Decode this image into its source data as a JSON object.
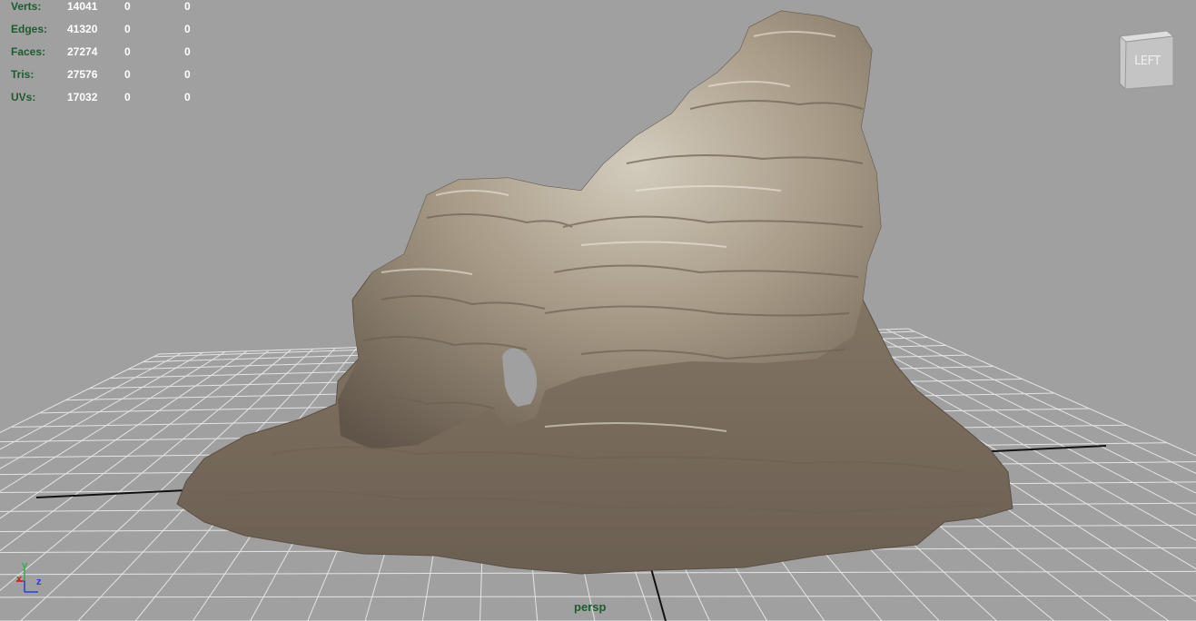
{
  "hud": {
    "rows": [
      {
        "label": "Verts:",
        "v1": "14041",
        "v2": "0",
        "v3": "0"
      },
      {
        "label": "Edges:",
        "v1": "41320",
        "v2": "0",
        "v3": "0"
      },
      {
        "label": "Faces:",
        "v1": "27274",
        "v2": "0",
        "v3": "0"
      },
      {
        "label": "Tris:",
        "v1": "27576",
        "v2": "0",
        "v3": "0"
      },
      {
        "label": "UVs:",
        "v1": "17032",
        "v2": "0",
        "v3": "0"
      }
    ]
  },
  "viewport": {
    "camera": "persp",
    "view_cube_face": "LEFT",
    "background": "#a0a0a0",
    "grid_color": "#e8e8e8",
    "axis_line_color": "#111111"
  },
  "axis_gizmo": {
    "y": "y",
    "x": "x",
    "z": "z"
  },
  "colors": {
    "hud_label": "#1e5c2e",
    "hud_value": "#ffffff",
    "axis_x": "#d02020",
    "axis_y": "#2db04c",
    "axis_z": "#2a3fd4"
  }
}
